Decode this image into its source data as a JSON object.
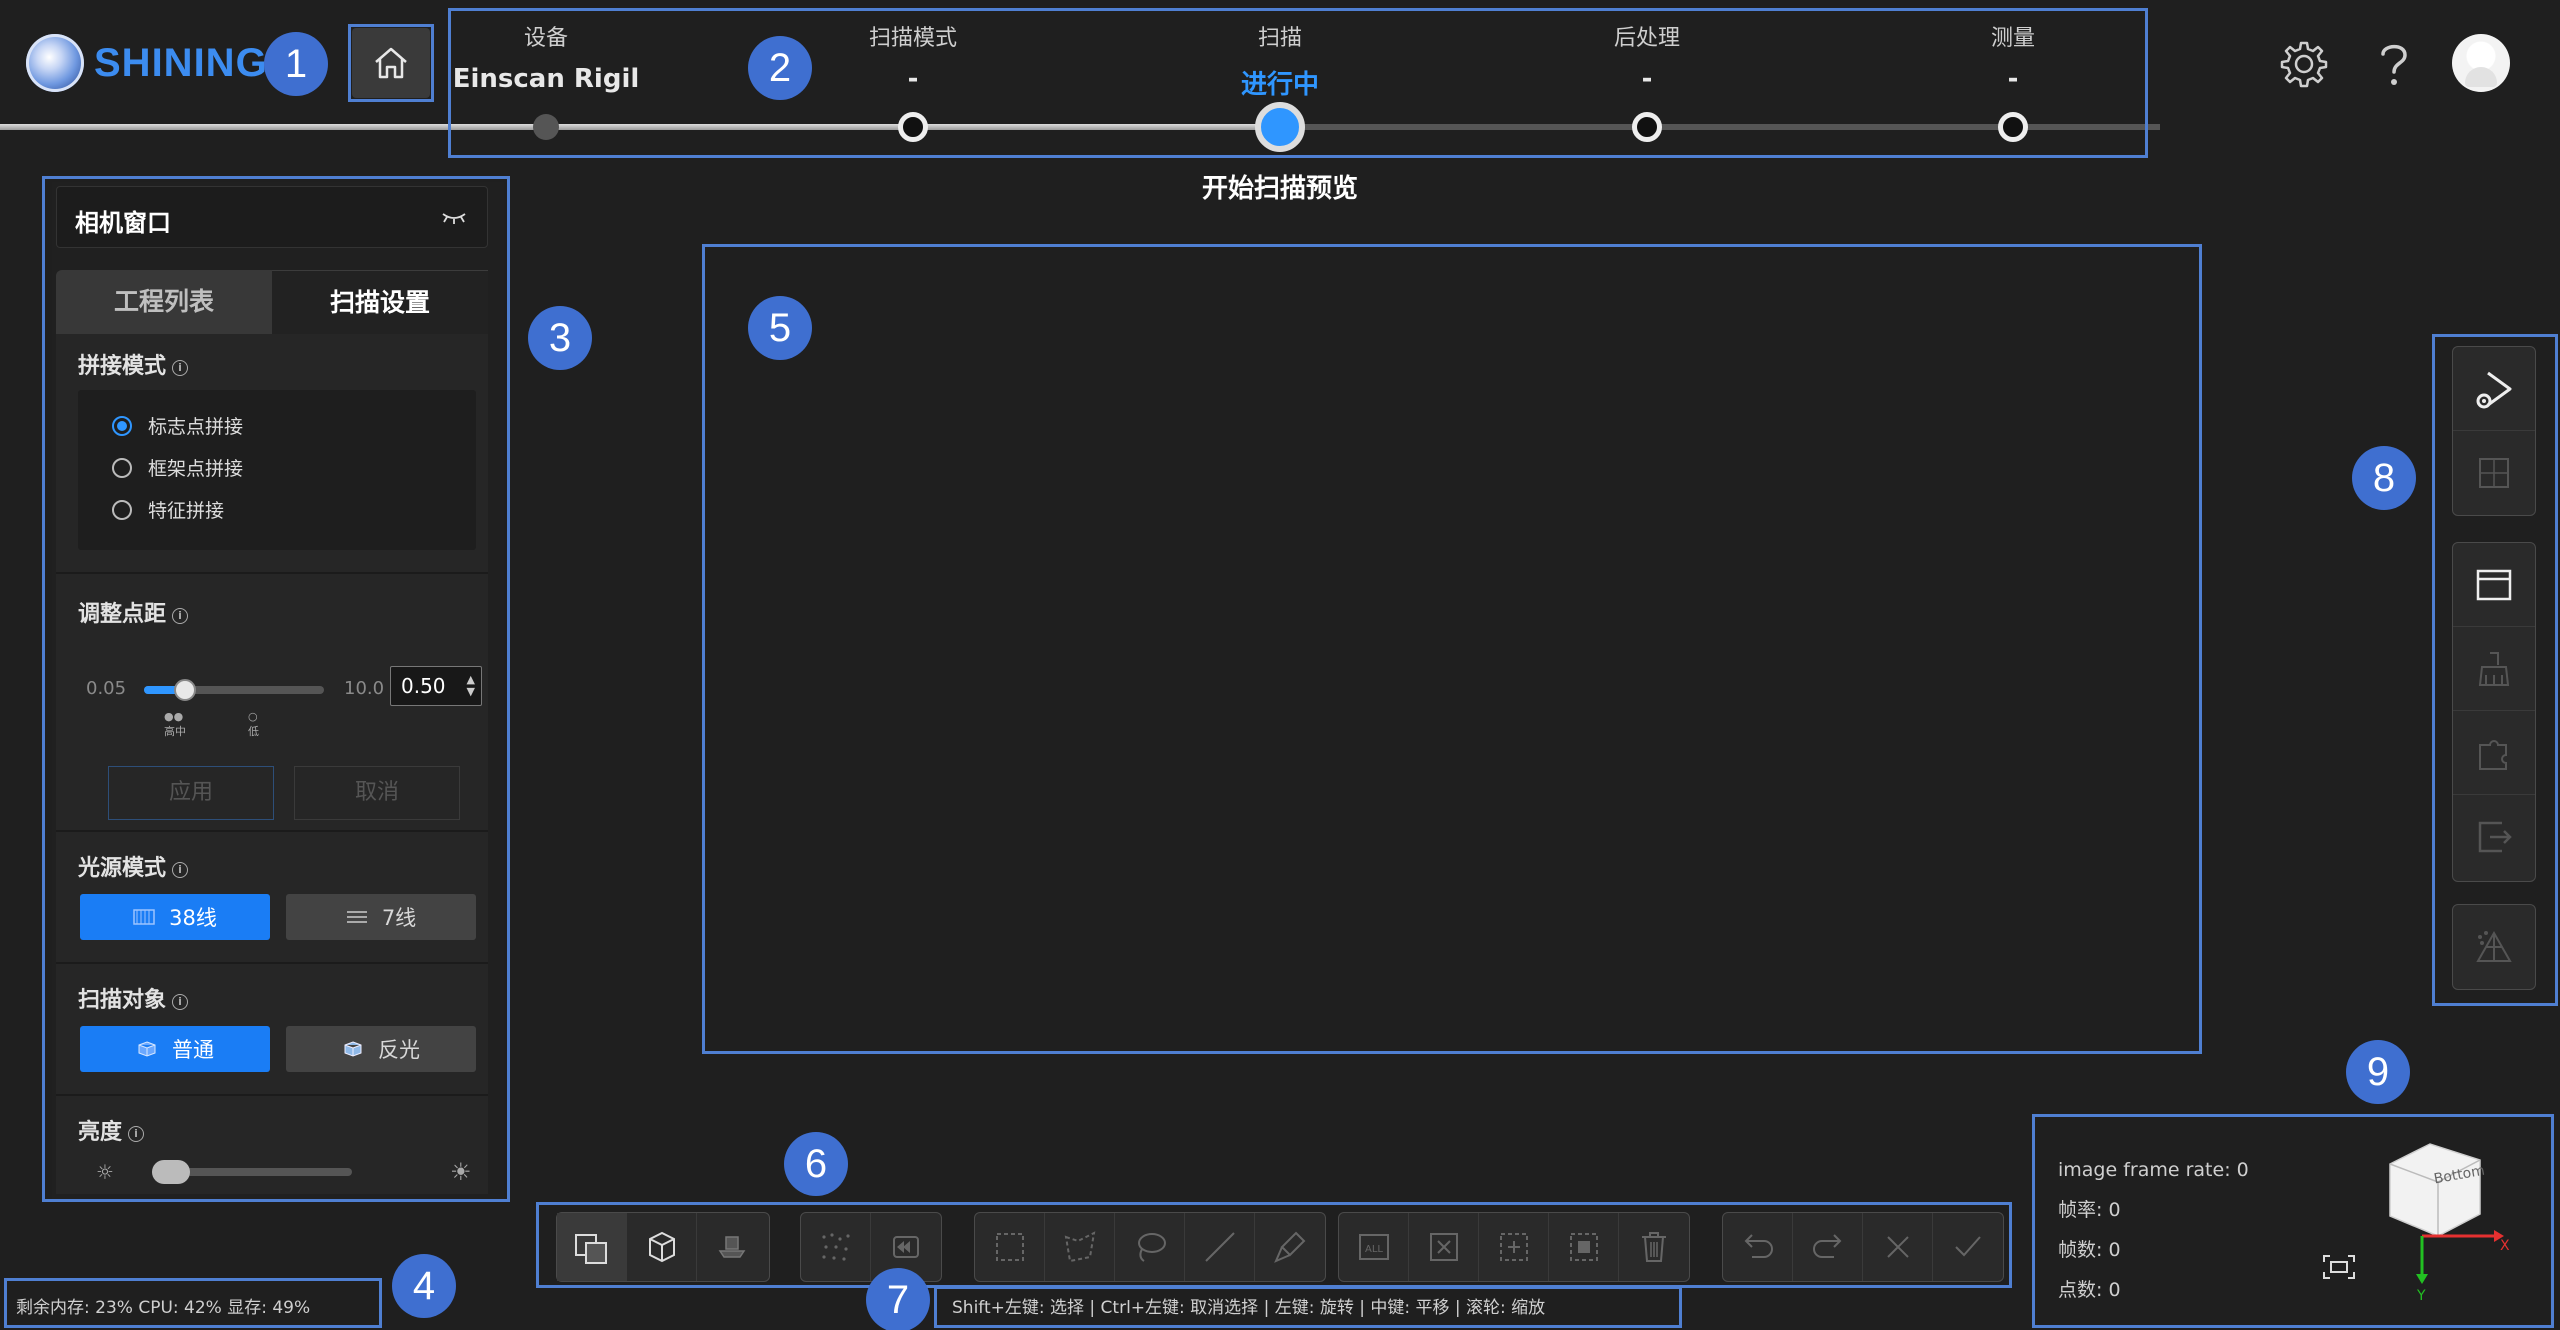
{
  "app": {
    "logo_text": "SHINING"
  },
  "steps": [
    {
      "label": "设备",
      "value": "Einscan Rigil"
    },
    {
      "label": "扫描模式",
      "value": "-"
    },
    {
      "label": "扫描",
      "value": "进行中"
    },
    {
      "label": "后处理",
      "value": "-"
    },
    {
      "label": "测量",
      "value": "-"
    }
  ],
  "preview_title": "开始扫描预览",
  "top_icons": [
    "gear-icon",
    "help-icon",
    "avatar"
  ],
  "panel": {
    "title": "相机窗口",
    "tabs": [
      "工程列表",
      "扫描设置"
    ],
    "active_tab": "扫描设置",
    "stitch": {
      "label": "拼接模式",
      "options": [
        "标志点拼接",
        "框架点拼接",
        "特征拼接"
      ],
      "selected": "标志点拼接"
    },
    "point_distance": {
      "label": "调整点距",
      "min": "0.05",
      "max": "10.0",
      "value": "0.50",
      "tick_labels": [
        "高中",
        "低"
      ]
    },
    "apply_label": "应用",
    "cancel_label": "取消",
    "light": {
      "label": "光源模式",
      "options": [
        "38线",
        "7线"
      ],
      "selected": "38线"
    },
    "object": {
      "label": "扫描对象",
      "options": [
        "普通",
        "反光"
      ],
      "selected": "普通"
    },
    "brightness": {
      "label": "亮度"
    }
  },
  "status": "剩余内存: 23%  CPU: 42%  显存: 49%",
  "hint": "Shift+左键: 选择 | Ctrl+左键: 取消选择 | 左键: 旋转 | 中键: 平移 | 滚轮: 缩放",
  "info": {
    "image_frame_rate": "image frame rate: 0",
    "frame_rate": "帧率: 0",
    "frame_count": "帧数: 0",
    "point_count": "点数: 0"
  },
  "view_cube": {
    "face": "Bottom",
    "x_axis": "X",
    "y_axis": "Y"
  },
  "annotations": [
    "1",
    "2",
    "3",
    "4",
    "5",
    "6",
    "7",
    "8",
    "9"
  ],
  "colors": {
    "accent": "#2f96ff",
    "annotation": "#4f7fd2",
    "badge": "#3f6fd0"
  }
}
